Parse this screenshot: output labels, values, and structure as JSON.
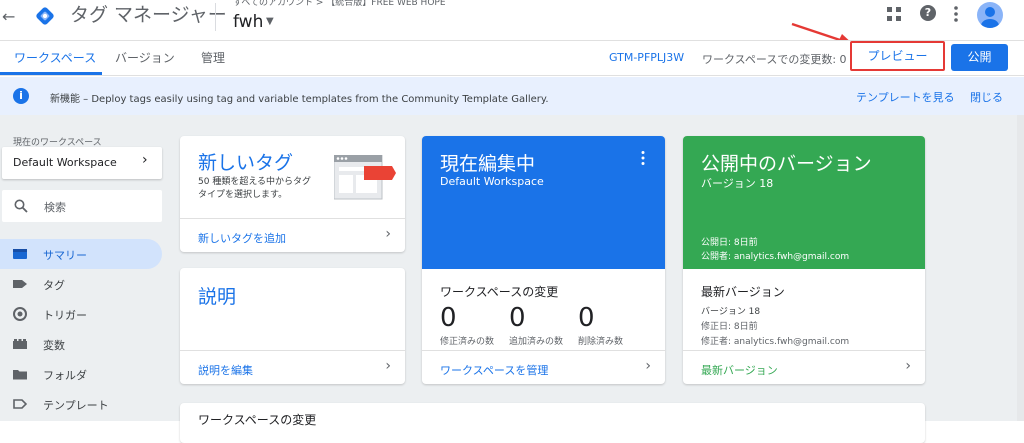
{
  "header": {
    "back_glyph": "←",
    "app_title": "タグ マネージャー",
    "breadcrumb": "すべてのアカウント > 【統合版】FREE WEB HOPE",
    "container_name": "fwh",
    "help_glyph": "?",
    "logo_icon": "gtm-diamond-logo",
    "apps_icon": "apps-grid-icon",
    "more_icon": "more-vert-icon"
  },
  "tabs": {
    "workspace": "ワークスペース",
    "versions": "バージョン",
    "admin": "管理",
    "container_id": "GTM-PFPLJ3W",
    "changes_label": "ワークスペースでの変更数: 0",
    "preview": "プレビュー",
    "publish": "公開"
  },
  "notice": {
    "text": "新機能 – Deploy tags easily using tag and variable templates from the Community Template Gallery.",
    "view_templates": "テンプレートを見る",
    "close": "閉じる",
    "info_glyph": "i"
  },
  "sidebar": {
    "workspace_label": "現在のワークスペース",
    "workspace_name": "Default Workspace",
    "search_placeholder": "検索",
    "items": [
      {
        "label": "サマリー",
        "icon": "summary-icon",
        "active": true
      },
      {
        "label": "タグ",
        "icon": "tag-icon",
        "active": false
      },
      {
        "label": "トリガー",
        "icon": "trigger-icon",
        "active": false
      },
      {
        "label": "変数",
        "icon": "variables-icon",
        "active": false
      },
      {
        "label": "フォルダ",
        "icon": "folder-icon",
        "active": false
      },
      {
        "label": "テンプレート",
        "icon": "template-icon",
        "active": false
      }
    ]
  },
  "cards": {
    "new_tag": {
      "title": "新しいタグ",
      "description": "50 種類を超える中からタグタイプを選択します。",
      "link": "新しいタグを追加"
    },
    "description": {
      "title": "説明",
      "link": "説明を編集"
    },
    "current_editing": {
      "title": "現在編集中",
      "subtitle": "Default Workspace",
      "changes_title": "ワークスペースの変更",
      "stats": [
        {
          "value": "0",
          "label": "修正済みの数"
        },
        {
          "value": "0",
          "label": "追加済みの数"
        },
        {
          "value": "0",
          "label": "削除済み数"
        }
      ],
      "link": "ワークスペースを管理"
    },
    "published": {
      "title": "公開中のバージョン",
      "version": "バージョン 18",
      "published_date": "公開日: 8日前",
      "published_by": "公開者: analytics.fwh@gmail.com",
      "latest_title": "最新バージョン",
      "latest_version": "バージョン 18",
      "modified_date": "修正日: 8日前",
      "modified_by": "修正者: analytics.fwh@gmail.com",
      "link": "最新バージョン"
    },
    "bottom": {
      "title": "ワークスペースの変更"
    }
  },
  "colors": {
    "primary": "#1a73e8",
    "publish_green": "#34a853",
    "annotation_red": "#e53935"
  }
}
